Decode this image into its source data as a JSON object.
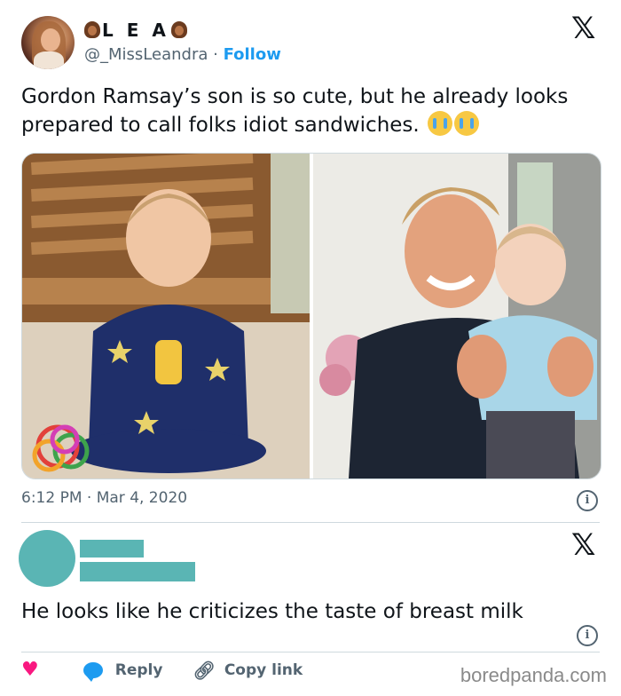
{
  "tweet": {
    "display_name": "L E A",
    "handle": "@_MissLeandra",
    "separator": "·",
    "follow_label": "Follow",
    "text": "Gordon Ramsay’s son is so cute, but he already looks prepared to call folks idiot sandwiches.",
    "emoji": [
      "loudly-crying-face",
      "loudly-crying-face"
    ],
    "timestamp": "6:12 PM · Mar 4, 2020",
    "info_glyph": "i"
  },
  "reply": {
    "text": "He looks like he criticizes the taste of breast milk",
    "info_glyph": "i"
  },
  "actions": {
    "like_icon": "heart-icon",
    "reply_label": "Reply",
    "copy_label": "Copy link"
  },
  "watermark": "boredpanda.com",
  "colors": {
    "follow": "#1d9bf0",
    "like": "#f91880",
    "reply_icon": "#1d9bf0",
    "redacted_placeholder": "#5ab5b4",
    "muted_text": "#536471"
  },
  "x_logo": "𝕏"
}
